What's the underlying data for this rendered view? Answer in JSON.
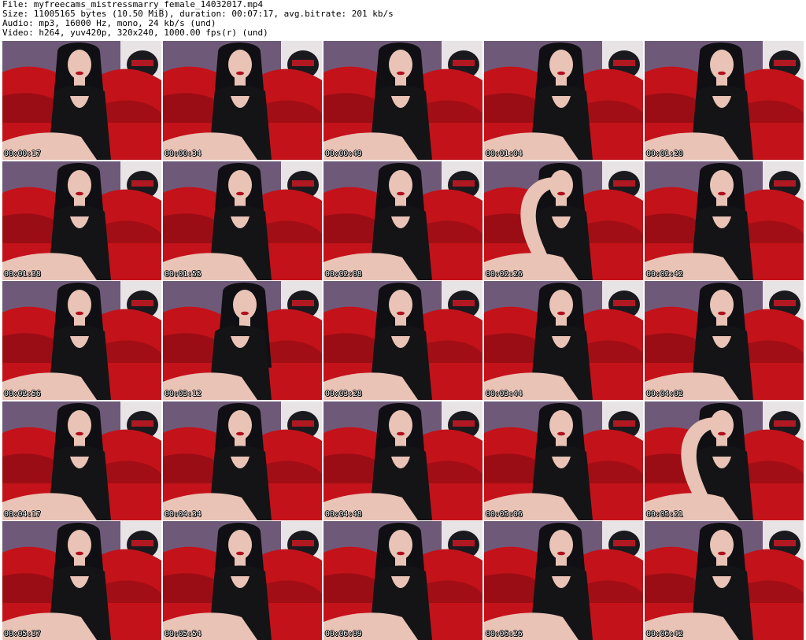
{
  "header": {
    "file": "File: myfreecams_mistressmarry_female_14032017.mp4",
    "size": "Size: 11005165 bytes (10.50 MiB), duration: 00:07:17, avg.bitrate: 201 kb/s",
    "audio": "Audio: mp3, 16000 Hz, mono, 24 kb/s (und)",
    "video": "Video: h264, yuv420p, 320x240, 1000.00 fps(r) (und)"
  },
  "colors": {
    "wall": "#6e5a78",
    "sofa": "#c4121a",
    "sofa_dark": "#7a0a10",
    "skin": "#e9c3b6",
    "hair": "#101014",
    "dress": "#141416",
    "poster": "#e8e4e6"
  },
  "thumbnails": [
    {
      "time": "00:00:17",
      "pose": "center"
    },
    {
      "time": "00:00:34",
      "pose": "center"
    },
    {
      "time": "00:00:49",
      "pose": "center"
    },
    {
      "time": "00:01:04",
      "pose": "center"
    },
    {
      "time": "00:01:20",
      "pose": "center"
    },
    {
      "time": "00:01:38",
      "pose": "center"
    },
    {
      "time": "00:01:55",
      "pose": "center"
    },
    {
      "time": "00:02:08",
      "pose": "center"
    },
    {
      "time": "00:02:26",
      "pose": "arm-up"
    },
    {
      "time": "00:02:42",
      "pose": "center"
    },
    {
      "time": "00:02:56",
      "pose": "center"
    },
    {
      "time": "00:03:12",
      "pose": "tilt"
    },
    {
      "time": "00:03:28",
      "pose": "center"
    },
    {
      "time": "00:03:44",
      "pose": "center"
    },
    {
      "time": "00:04:02",
      "pose": "center"
    },
    {
      "time": "00:04:17",
      "pose": "center"
    },
    {
      "time": "00:04:34",
      "pose": "center"
    },
    {
      "time": "00:04:48",
      "pose": "center"
    },
    {
      "time": "00:05:06",
      "pose": "center"
    },
    {
      "time": "00:05:21",
      "pose": "arm-up"
    },
    {
      "time": "00:05:37",
      "pose": "center"
    },
    {
      "time": "00:05:54",
      "pose": "center"
    },
    {
      "time": "00:06:09",
      "pose": "center"
    },
    {
      "time": "00:06:26",
      "pose": "center"
    },
    {
      "time": "00:06:42",
      "pose": "center"
    }
  ]
}
